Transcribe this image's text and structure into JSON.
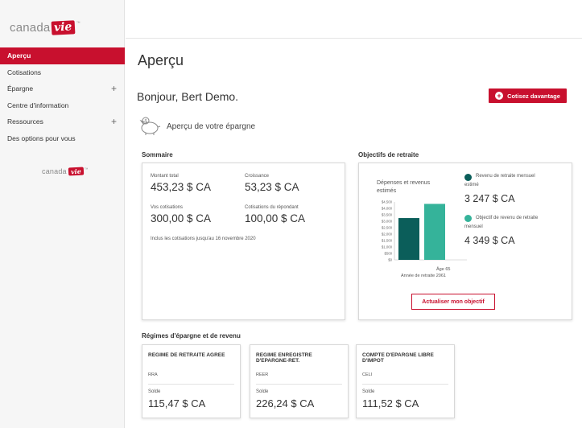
{
  "brand": {
    "name": "canada",
    "mark": "vie",
    "tm": "™"
  },
  "nav": [
    {
      "label": "Aperçu",
      "active": true,
      "expandable": false
    },
    {
      "label": "Cotisations",
      "active": false,
      "expandable": false
    },
    {
      "label": "Épargne",
      "active": false,
      "expandable": true
    },
    {
      "label": "Centre d'information",
      "active": false,
      "expandable": false
    },
    {
      "label": "Ressources",
      "active": false,
      "expandable": true
    },
    {
      "label": "Des options pour vous",
      "active": false,
      "expandable": false
    }
  ],
  "nav_plus": "+",
  "page_title": "Aperçu",
  "greeting": "Bonjour, Bert Demo.",
  "cta": {
    "label": "Cotisez davantage",
    "icon": "plus-circle-icon"
  },
  "savings_heading": "Aperçu de votre épargne",
  "summary": {
    "title": "Sommaire",
    "total_label": "Montant total",
    "total_value": "453,23 $ CA",
    "growth_label": "Croissance",
    "growth_value": "53,23 $ CA",
    "your_label": "Vos cotisations",
    "your_value": "300,00 $ CA",
    "sponsor_label": "Cotisations du répondant",
    "sponsor_value": "100,00 $ CA",
    "note": "Inclus les cotisations jusqu'au 16 novembre 2020"
  },
  "objectives": {
    "title": "Objectifs de retraite",
    "chart_title_line1": "Dépenses et revenus",
    "chart_title_line2": "estimés",
    "estimated_label_line1": "Revenu de retraite mensuel",
    "estimated_label_line2": "estimé",
    "estimated_value": "3 247 $ CA",
    "goal_label_line1": "Objectif de revenu de retraite",
    "goal_label_line2": "mensuel",
    "goal_value": "4 349 $ CA",
    "x_label_line1": "Âge 65",
    "x_label_line2": "Année de retraite 2061",
    "button": "Actualiser mon objectif",
    "colors": {
      "estimated": "#0b5e5a",
      "goal": "#35b39a"
    }
  },
  "chart_data": {
    "type": "bar",
    "title": "Dépenses et revenus estimés",
    "categories": [
      "Revenu de retraite mensuel estimé",
      "Objectif de revenu de retraite mensuel"
    ],
    "values": [
      3247,
      4349
    ],
    "colors": [
      "#0b5e5a",
      "#35b39a"
    ],
    "ylim": [
      0,
      4500
    ],
    "yticks": [
      "$4,500",
      "$4,000",
      "$3,500",
      "$3,000",
      "$2,500",
      "$2,000",
      "$1,500",
      "$1,000",
      "$500",
      "$0"
    ],
    "xlabel": "Âge 65 Année de retraite 2061"
  },
  "accounts_title": "Régimes d'épargne et de revenu",
  "accounts": [
    {
      "name": "REGIME DE RETRAITE AGREE",
      "code": "RRA",
      "balance_label": "Solde",
      "balance": "115,47 $ CA"
    },
    {
      "name": "REGIME ENREGISTRE D'EPARGNE-RET.",
      "code": "REER",
      "balance_label": "Solde",
      "balance": "226,24 $ CA"
    },
    {
      "name": "COMPTE D'EPARGNE LIBRE D'IMPOT",
      "code": "CELI",
      "balance_label": "Solde",
      "balance": "111,52 $ CA"
    }
  ]
}
